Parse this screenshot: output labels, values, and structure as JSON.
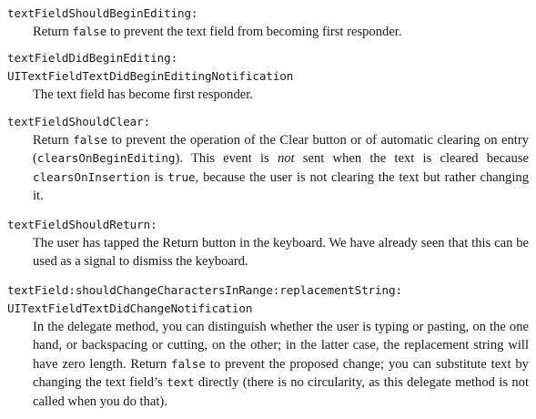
{
  "entries": [
    {
      "terms": [
        "textFieldShouldBeginEditing:"
      ],
      "desc": [
        {
          "t": "Return "
        },
        {
          "c": "false"
        },
        {
          "t": " to prevent the text field from becoming first responder."
        }
      ]
    },
    {
      "terms": [
        "textFieldDidBeginEditing:",
        "UITextFieldTextDidBeginEditingNotification"
      ],
      "desc": [
        {
          "t": "The text field has become first responder."
        }
      ]
    },
    {
      "terms": [
        "textFieldShouldClear:"
      ],
      "desc": [
        {
          "t": "Return "
        },
        {
          "c": "false"
        },
        {
          "t": " to prevent the operation of the Clear button or of automatic clearing on entry ("
        },
        {
          "c": "clearsOnBeginEditing"
        },
        {
          "t": "). This event is "
        },
        {
          "i": "not"
        },
        {
          "t": " sent when the text is cleared because "
        },
        {
          "c": "clearsOnInsertion"
        },
        {
          "t": " is "
        },
        {
          "c": "true"
        },
        {
          "t": ", because the user is not clearing the text but rather changing it."
        }
      ]
    },
    {
      "terms": [
        "textFieldShouldReturn:"
      ],
      "desc": [
        {
          "t": "The user has tapped the Return button in the keyboard. We have already seen that this can be used as a signal to dismiss the keyboard."
        }
      ]
    },
    {
      "terms": [
        "textField:shouldChangeCharactersInRange:replacementString:",
        "UITextFieldTextDidChangeNotification"
      ],
      "desc": [
        {
          "t": "In the delegate method, you can distinguish whether the user is typing or pasting, on the one hand, or backspacing or cutting, on the other; in the latter case, the replacement string will have zero length. Return "
        },
        {
          "c": "false"
        },
        {
          "t": " to prevent the proposed change; you can substitute text by changing the text field’s "
        },
        {
          "c": "text"
        },
        {
          "t": " directly (there is no circularity, as this delegate method is not called when you do that)."
        }
      ]
    }
  ]
}
